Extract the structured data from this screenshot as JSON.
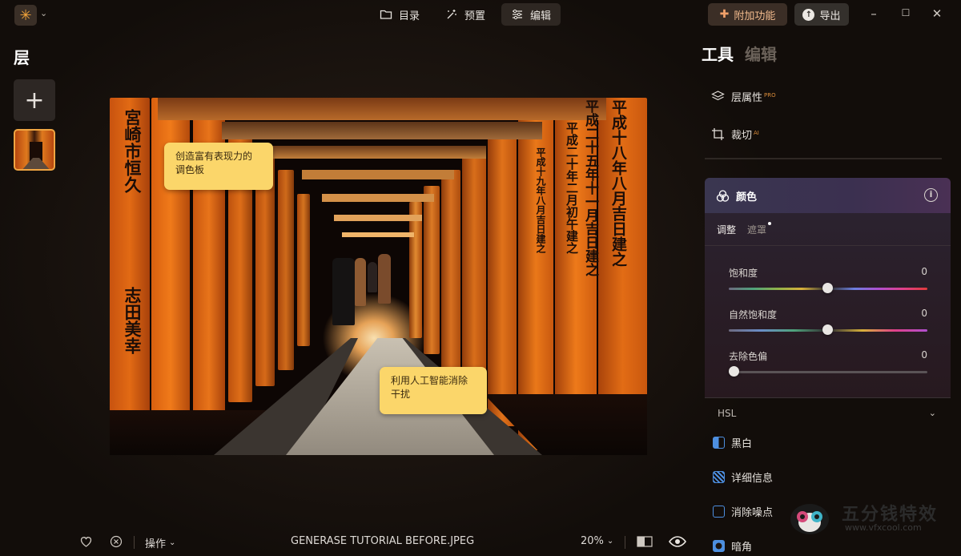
{
  "titlebar": {
    "tabs": [
      {
        "label": "目录",
        "icon": "folder-icon"
      },
      {
        "label": "预置",
        "icon": "magic-wand-icon"
      },
      {
        "label": "编辑",
        "icon": "sliders-icon",
        "active": true
      }
    ],
    "addon_label": "附加功能",
    "export_label": "导出"
  },
  "layers": {
    "title": "层",
    "add_symbol": "+"
  },
  "photo": {
    "callout_top": "创造富有表现力的\n调色板",
    "callout_bottom": "利用人工智能消除\n干扰",
    "kanji_columns": [
      "宮崎市恒久",
      "志田美幸",
      "平成十八年八月吉日建之",
      "平成二十五年十一月吉日建之",
      "平成二十年二月初午建之",
      "平成十九年八月吉日建之"
    ]
  },
  "bottombar": {
    "actions_label": "操作",
    "filename": "GENERASE TUTORIAL BEFORE.JPEG",
    "zoom": "20%"
  },
  "panel": {
    "tabs": [
      {
        "label": "工具",
        "active": true
      },
      {
        "label": "编辑",
        "active": false
      }
    ],
    "tools_top": [
      {
        "label": "层属性",
        "badge": "PRO"
      },
      {
        "label": "裁切",
        "badge": "AI"
      }
    ],
    "color": {
      "title": "颜色",
      "subtabs": [
        "调整",
        "遮罩"
      ],
      "sliders": [
        {
          "label": "饱和度",
          "value": "0",
          "level": 0.5
        },
        {
          "label": "自然饱和度",
          "value": "0",
          "level": 0.5
        },
        {
          "label": "去除色偏",
          "value": "0",
          "level": 0.0
        }
      ]
    },
    "hsl_label": "HSL",
    "tools_bottom": [
      {
        "label": "黑白",
        "icon": "black-white-icon"
      },
      {
        "label": "详细信息",
        "icon": "detail-icon"
      },
      {
        "label": "消除噪点",
        "icon": "denoise-icon"
      },
      {
        "label": "暗角",
        "icon": "vignette-icon"
      }
    ]
  },
  "watermark": {
    "text": "五分钱特效",
    "url": "www.vfxcool.com"
  }
}
